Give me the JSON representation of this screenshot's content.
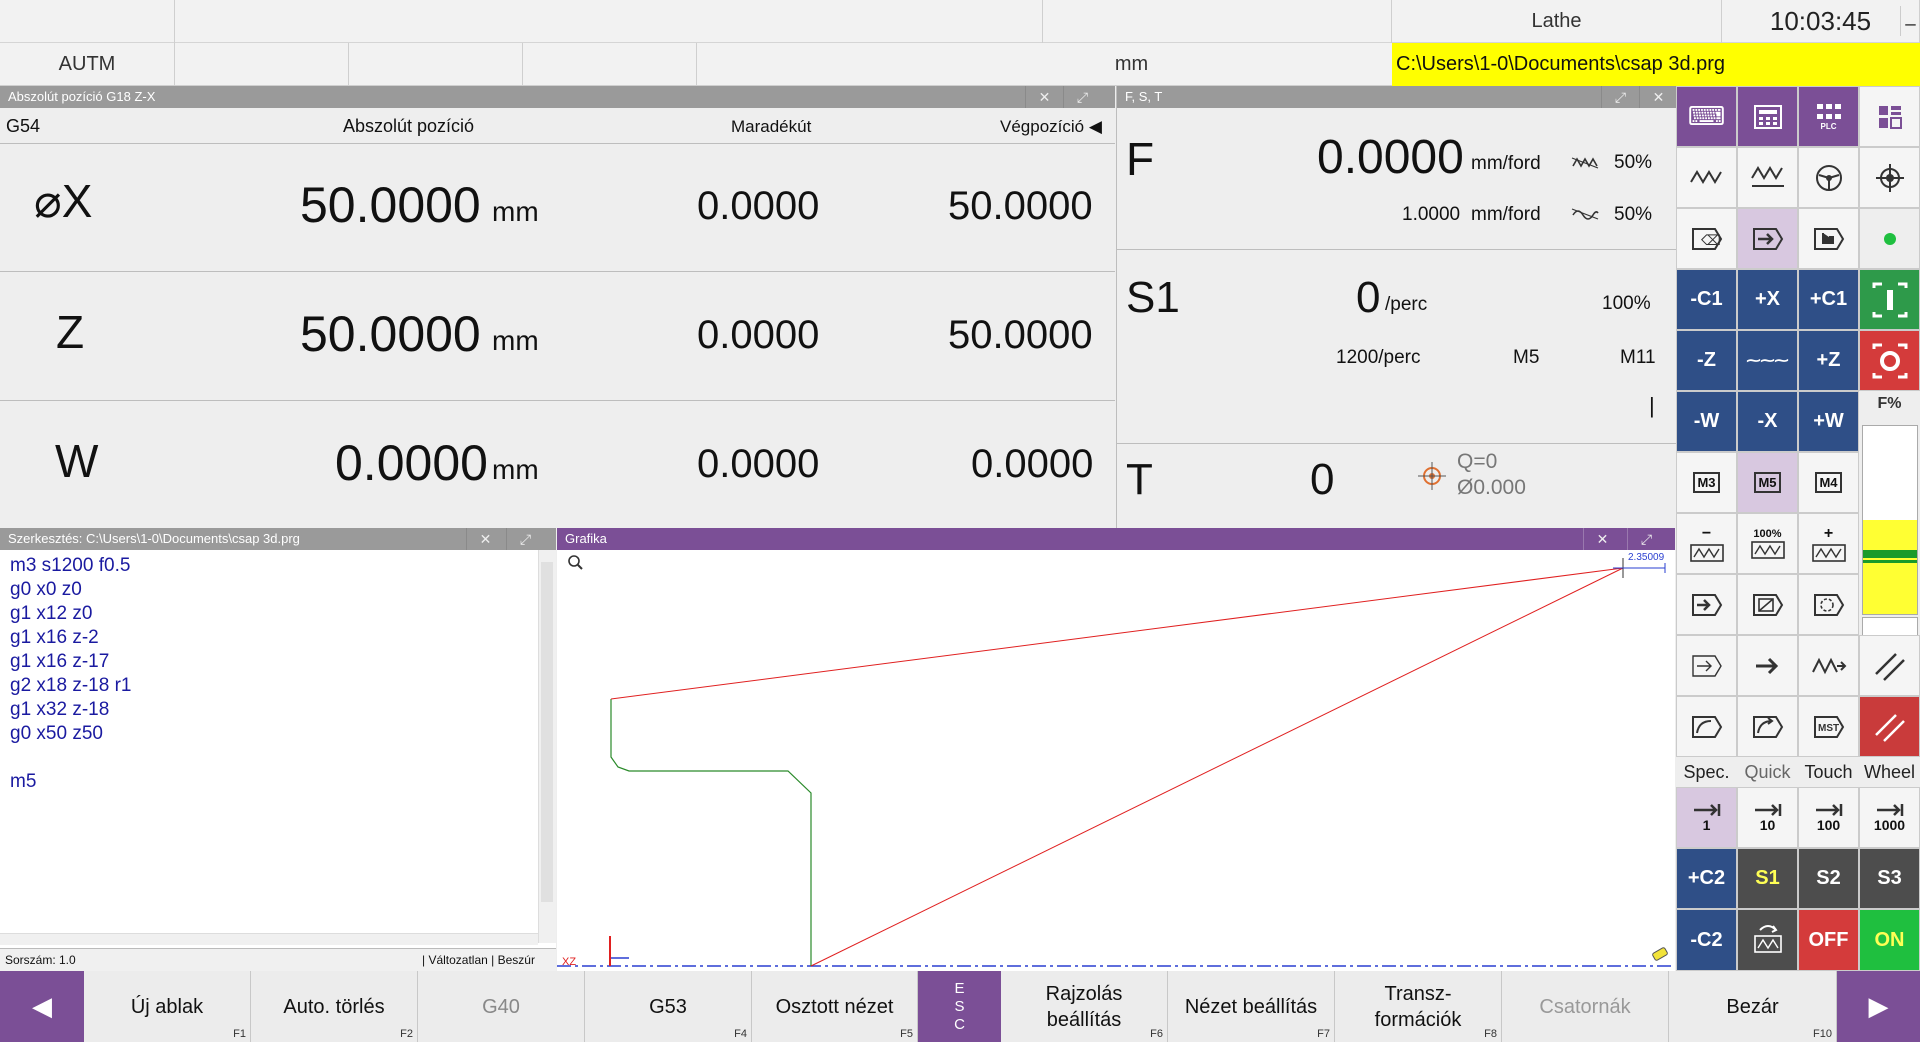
{
  "status_bar": {
    "machine": "Lathe",
    "clock": "10:03:45",
    "mode": "AUTM",
    "units": "mm",
    "file_path": "C:\\Users\\1-0\\Documents\\csap 3d.prg",
    "minimize": "_"
  },
  "position_panel": {
    "title": "Abszolút pozíció G18 Z-X",
    "close": "✕",
    "expand": "⤢",
    "coord_system": "G54",
    "col_absolute": "Abszolút pozíció",
    "col_remaining": "Maradékút",
    "col_end": "Végpozíció ◀",
    "axes": [
      {
        "name": "⌀X",
        "absolute": "50.0000",
        "unit": "mm",
        "remaining": "0.0000",
        "end": "50.0000"
      },
      {
        "name": "Z",
        "absolute": "50.0000",
        "unit": "mm",
        "remaining": "0.0000",
        "end": "50.0000"
      },
      {
        "name": "W",
        "absolute": "0.0000",
        "unit": "mm",
        "remaining": "0.0000",
        "end": "0.0000"
      }
    ]
  },
  "fst_panel": {
    "title": "F, S, T",
    "close": "✕",
    "expand": "⤢",
    "f_label": "F",
    "f_value": "0.0000",
    "f_unit": "mm/ford",
    "f_override": "50%",
    "f_prog": "1.0000",
    "f_prog_unit": "mm/ford",
    "f_rapid_override": "50%",
    "s_label": "S1",
    "s_value": "0",
    "s_unit": "/perc",
    "s_override": "100%",
    "s_prog": "1200/perc",
    "s_mcode": "M5",
    "s_gear": "M11",
    "s_bar": "|",
    "t_label": "T",
    "t_value": "0",
    "t_q": "Q=0",
    "t_dia": "Ø0.000"
  },
  "editor": {
    "title": "Szerkesztés: C:\\Users\\1-0\\Documents\\csap 3d.prg",
    "close": "✕",
    "expand": "⤢",
    "lines": [
      "m3 s1200 f0.5",
      "g0 x0 z0",
      "g1 x12 z0",
      "g1 x16 z-2",
      "g1 x16 z-17",
      "g2 x18 z-18 r1",
      "g1 x32 z-18",
      "g0 x50 z50",
      "",
      "m5"
    ],
    "status_left": "Sorszám: 1.0",
    "status_right": "| Változatlan | Beszúr"
  },
  "graphics": {
    "title": "Grafika",
    "close": "✕",
    "expand": "⤢",
    "scale_label": "2.35009",
    "plane_label": "XZ"
  },
  "right_panel": {
    "jog_minus_c1": "-C1",
    "jog_plus_x": "+X",
    "jog_plus_c1": "+C1",
    "jog_minus_z": "-Z",
    "jog_rapid": "⁓⁓⁓",
    "jog_plus_z": "+Z",
    "jog_minus_w": "-W",
    "jog_minus_x": "-X",
    "jog_plus_w": "+W",
    "m3": "M3",
    "m5": "M5",
    "m4": "M4",
    "spindle_minus": "−",
    "spindle_100": "100%",
    "spindle_plus": "+",
    "feed_label": "F%",
    "mode_spec": "Spec.",
    "mode_quick": "Quick",
    "mode_touch": "Touch",
    "mode_wheel": "Wheel",
    "inc_1": "1",
    "inc_10": "10",
    "inc_100": "100",
    "inc_1000": "1000",
    "plus_c2": "+C2",
    "s1": "S1",
    "s2": "S2",
    "s3": "S3",
    "minus_c2": "-C2",
    "off": "OFF",
    "on": "ON",
    "kbd_label": "⌨",
    "plc_label": "PLC",
    "feed_fill_pct": 0.5
  },
  "function_bar": {
    "prev": "◀",
    "next": "▶",
    "esc": "E S C",
    "buttons": [
      {
        "label": "Új ablak",
        "key": "F1"
      },
      {
        "label": "Auto. törlés",
        "key": "F2"
      },
      {
        "label": "G40",
        "key": ""
      },
      {
        "label": "G53",
        "key": "F4"
      },
      {
        "label": "Osztott nézet",
        "key": "F5"
      },
      {
        "label": "Rajzolás beállítás",
        "key": "F6"
      },
      {
        "label": "Nézet beállítás",
        "key": "F7"
      },
      {
        "label": "Transz-formációk",
        "key": "F8"
      },
      {
        "label": "Csatornák",
        "key": ""
      },
      {
        "label": "Bezár",
        "key": "F10"
      }
    ]
  },
  "colors": {
    "accent": "#7b4f96",
    "title_gray": "#9a9a9a",
    "nav_blue": "#2f4f87",
    "path_red": "#e02020",
    "path_green": "#2a8a2a",
    "file_yellow": "#ffff00"
  }
}
